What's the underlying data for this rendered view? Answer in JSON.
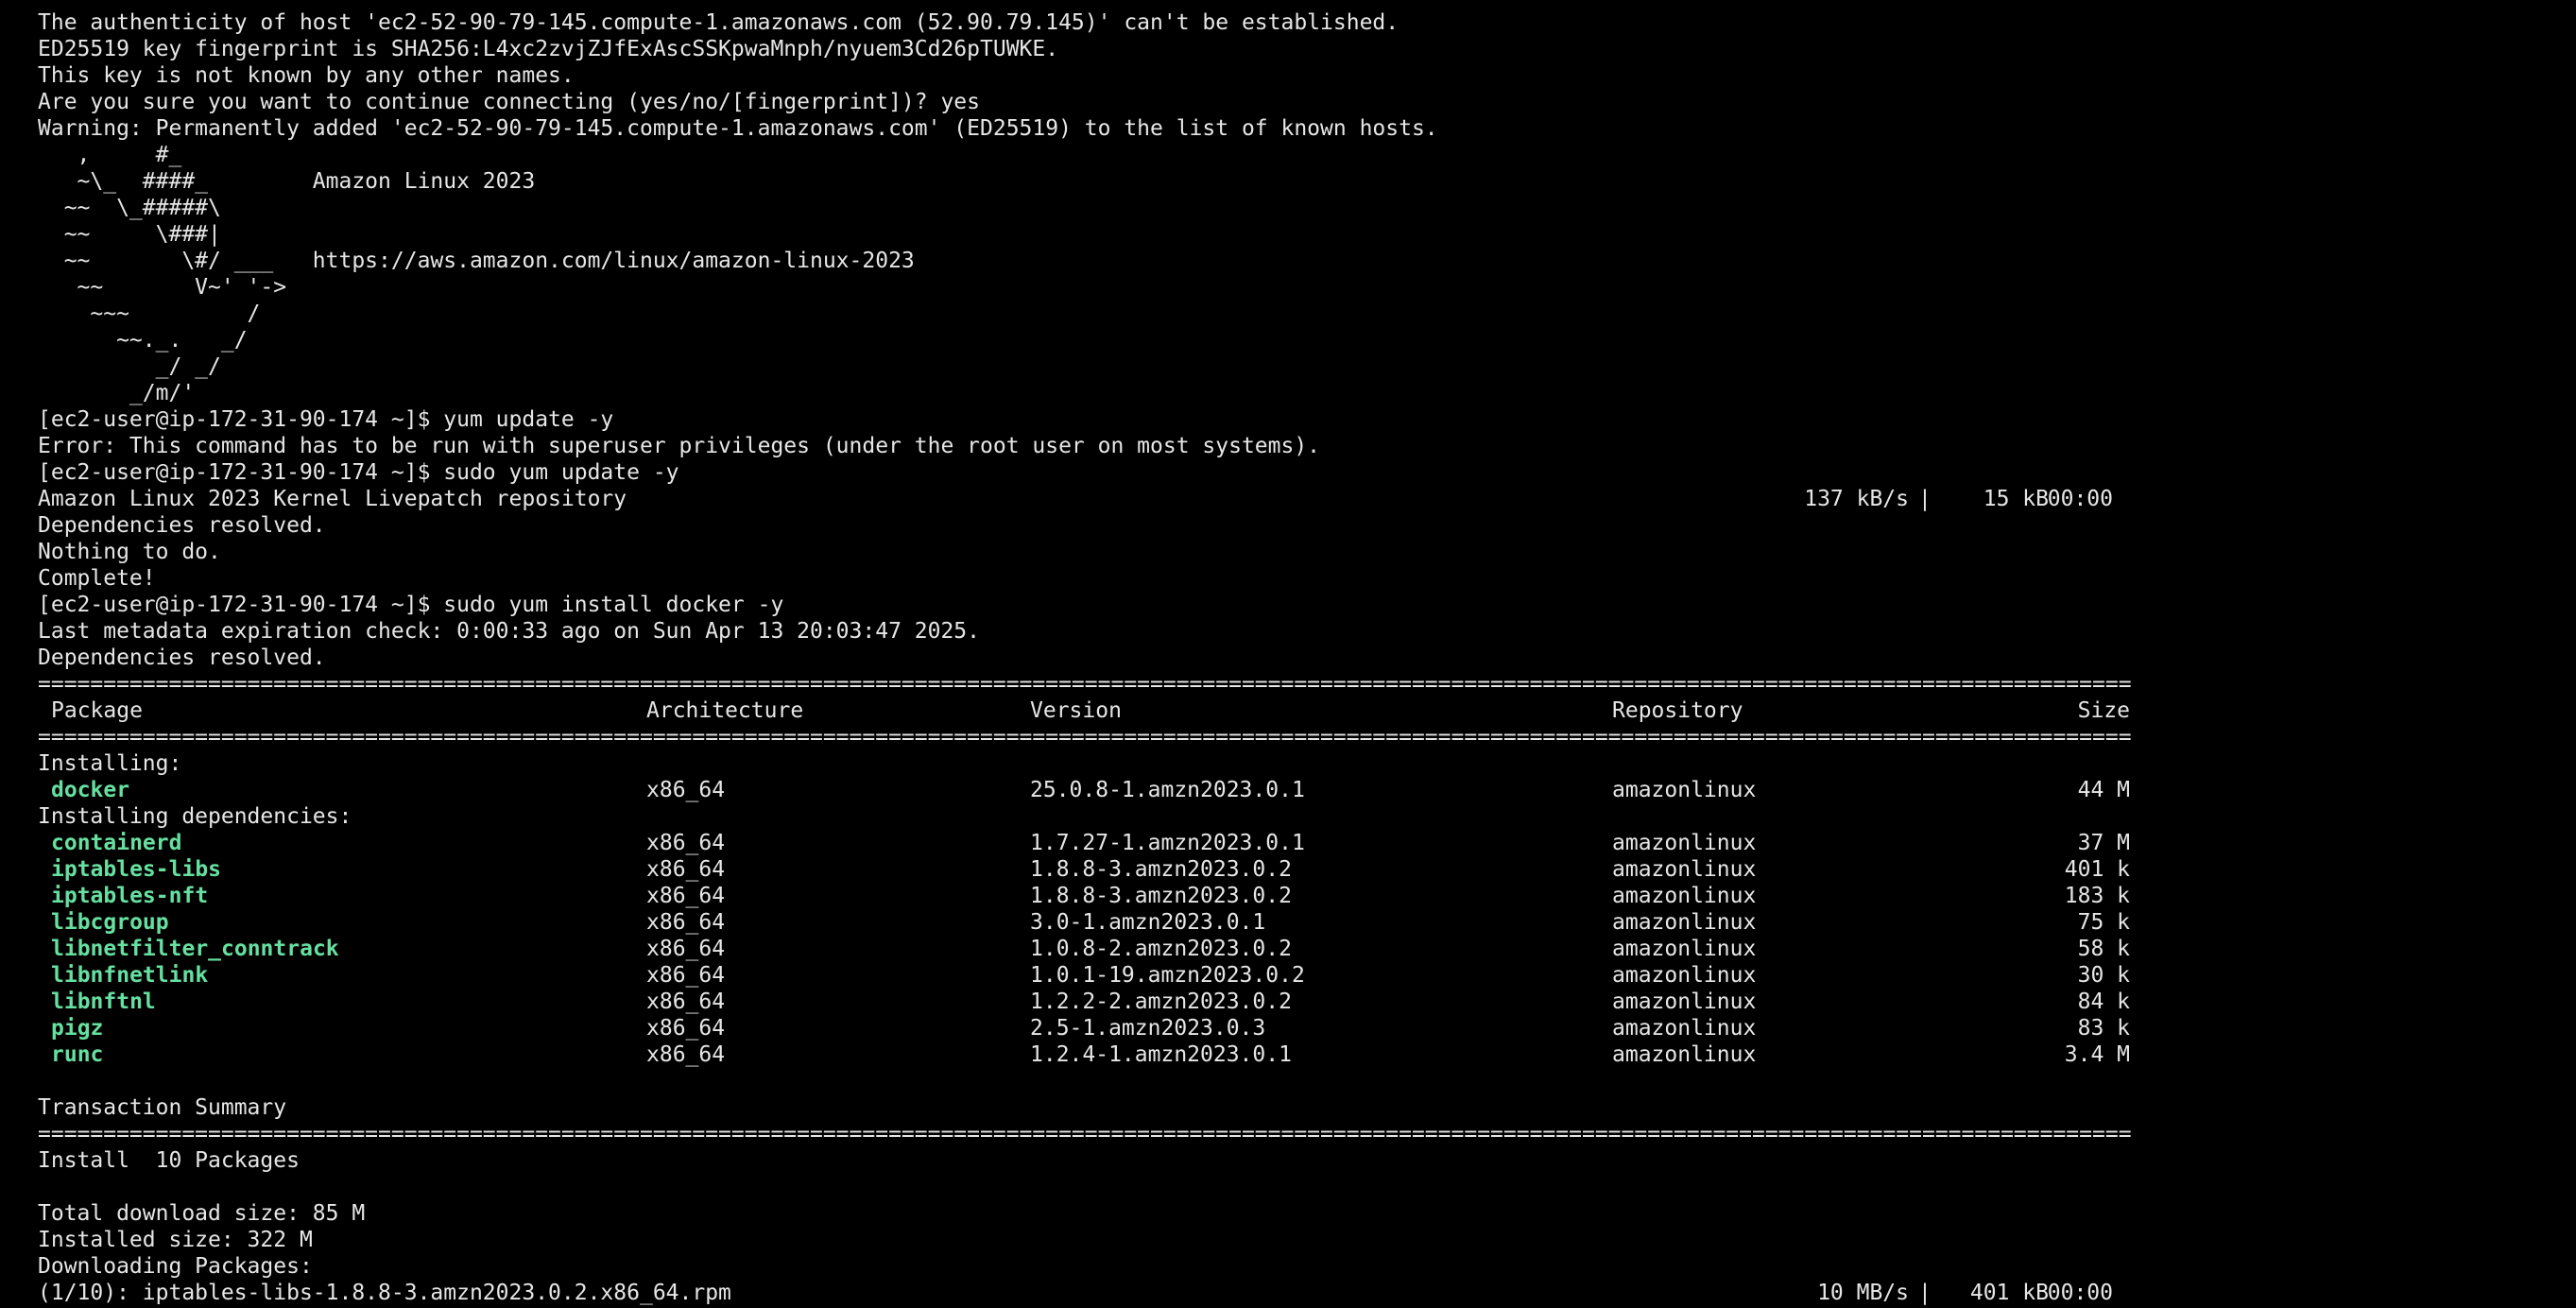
{
  "terminal": {
    "ssh": {
      "authenticity": "The authenticity of host 'ec2-52-90-79-145.compute-1.amazonaws.com (52.90.79.145)' can't be established.",
      "fingerprint": "ED25519 key fingerprint is SHA256:L4xc2zvjZJfExAscSSKpwaMnph/nyuem3Cd26pTUWKE.",
      "not_known": "This key is not known by any other names.",
      "continue_prompt": "Are you sure you want to continue connecting (yes/no/[fingerprint])? yes",
      "warning": "Warning: Permanently added 'ec2-52-90-79-145.compute-1.amazonaws.com' (ED25519) to the list of known hosts."
    },
    "banner": {
      "lines": [
        "   ,     #_",
        "   ~\\_  ####_        Amazon Linux 2023",
        "  ~~  \\_#####\\",
        "  ~~     \\###|",
        "  ~~       \\#/ ___   https://aws.amazon.com/linux/amazon-linux-2023",
        "   ~~       V~' '->",
        "    ~~~         /",
        "      ~~._.   _/",
        "         _/ _/",
        "       _/m/'"
      ]
    },
    "session1": {
      "prompt1": "[ec2-user@ip-172-31-90-174 ~]$ yum update -y",
      "error": "Error: This command has to be run with superuser privileges (under the root user on most systems).",
      "prompt2": "[ec2-user@ip-172-31-90-174 ~]$ sudo yum update -y",
      "repo_line": {
        "name": "Amazon Linux 2023 Kernel Livepatch repository",
        "speed": "137 kB/s",
        "sep": "|",
        "amount": "15 kB",
        "time": "00:00"
      },
      "deps_resolved": "Dependencies resolved.",
      "nothing": "Nothing to do.",
      "complete": "Complete!",
      "prompt3": "[ec2-user@ip-172-31-90-174 ~]$ sudo yum install docker -y",
      "metadata": "Last metadata expiration check: 0:00:33 ago on Sun Apr 13 20:03:47 2025.",
      "deps_resolved2": "Dependencies resolved."
    },
    "table": {
      "rule": "================================================================================================================================================================",
      "headers": {
        "package": "Package",
        "architecture": "Architecture",
        "version": "Version",
        "repository": "Repository",
        "size": "Size"
      },
      "installing_label": "Installing:",
      "installing": [
        {
          "name": "docker",
          "arch": "x86_64",
          "version": "25.0.8-1.amzn2023.0.1",
          "repo": "amazonlinux",
          "size": "44 M"
        }
      ],
      "deps_label": "Installing dependencies:",
      "dependencies": [
        {
          "name": "containerd",
          "arch": "x86_64",
          "version": "1.7.27-1.amzn2023.0.1",
          "repo": "amazonlinux",
          "size": "37 M"
        },
        {
          "name": "iptables-libs",
          "arch": "x86_64",
          "version": "1.8.8-3.amzn2023.0.2",
          "repo": "amazonlinux",
          "size": "401 k"
        },
        {
          "name": "iptables-nft",
          "arch": "x86_64",
          "version": "1.8.8-3.amzn2023.0.2",
          "repo": "amazonlinux",
          "size": "183 k"
        },
        {
          "name": "libcgroup",
          "arch": "x86_64",
          "version": "3.0-1.amzn2023.0.1",
          "repo": "amazonlinux",
          "size": "75 k"
        },
        {
          "name": "libnetfilter_conntrack",
          "arch": "x86_64",
          "version": "1.0.8-2.amzn2023.0.2",
          "repo": "amazonlinux",
          "size": "58 k"
        },
        {
          "name": "libnfnetlink",
          "arch": "x86_64",
          "version": "1.0.1-19.amzn2023.0.2",
          "repo": "amazonlinux",
          "size": "30 k"
        },
        {
          "name": "libnftnl",
          "arch": "x86_64",
          "version": "1.2.2-2.amzn2023.0.2",
          "repo": "amazonlinux",
          "size": "84 k"
        },
        {
          "name": "pigz",
          "arch": "x86_64",
          "version": "2.5-1.amzn2023.0.3",
          "repo": "amazonlinux",
          "size": "83 k"
        },
        {
          "name": "runc",
          "arch": "x86_64",
          "version": "1.2.4-1.amzn2023.0.1",
          "repo": "amazonlinux",
          "size": "3.4 M"
        }
      ]
    },
    "summary": {
      "title": "Transaction Summary",
      "install": "Install  10 Packages",
      "download_size": "Total download size: 85 M",
      "installed_size": "Installed size: 322 M",
      "downloading": "Downloading Packages:",
      "download_line": {
        "name": "(1/10): iptables-libs-1.8.8-3.amzn2023.0.2.x86_64.rpm",
        "speed": "10 MB/s",
        "sep": "|",
        "amount": "401 kB",
        "time": "00:00"
      }
    },
    "colors": {
      "background": "#000000",
      "text": "#e6e6e6",
      "package_name": "#66e0a0"
    }
  }
}
